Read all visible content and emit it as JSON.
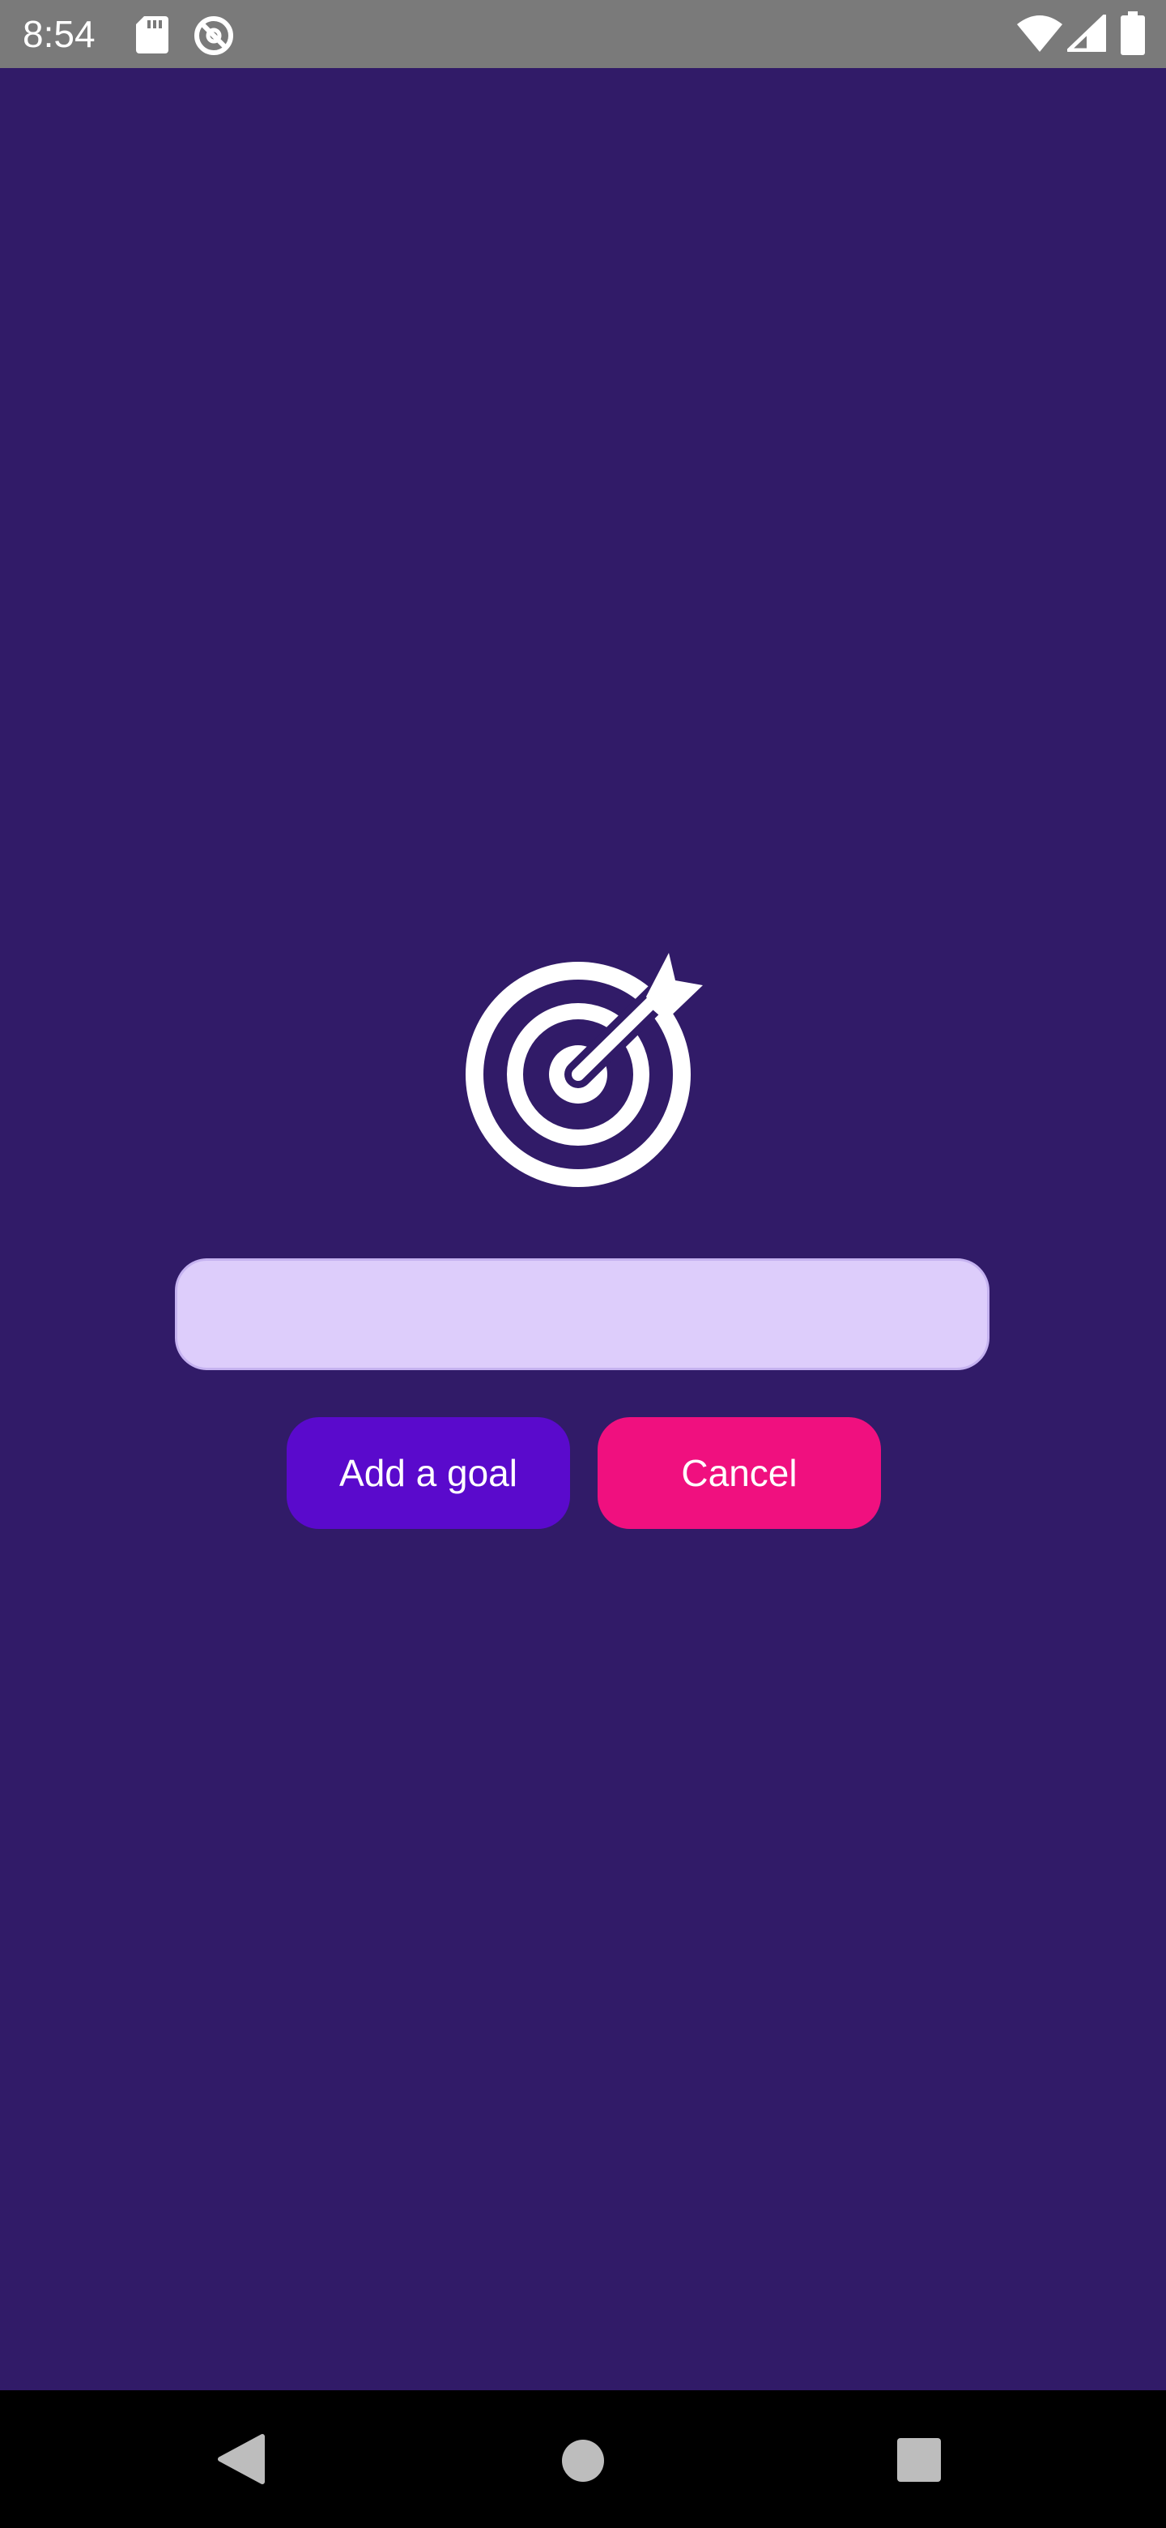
{
  "status_bar": {
    "time": "8:54",
    "icons": [
      "sd-card-icon",
      "do-not-disturb-icon",
      "wifi-icon",
      "cell-signal-icon",
      "battery-icon"
    ]
  },
  "main": {
    "icon": "target-icon",
    "goal_input": {
      "value": "",
      "placeholder": ""
    },
    "add_button_label": "Add a goal",
    "cancel_button_label": "Cancel"
  },
  "nav_bar": {
    "icons": [
      "back-icon",
      "home-icon",
      "recents-icon"
    ]
  },
  "colors": {
    "background": "#311b68",
    "status_bar": "#7a7a7a",
    "input_background": "#ddcdfb",
    "add_button": "#5a0acc",
    "cancel_button": "#f0107f",
    "nav_bar": "#000000"
  }
}
